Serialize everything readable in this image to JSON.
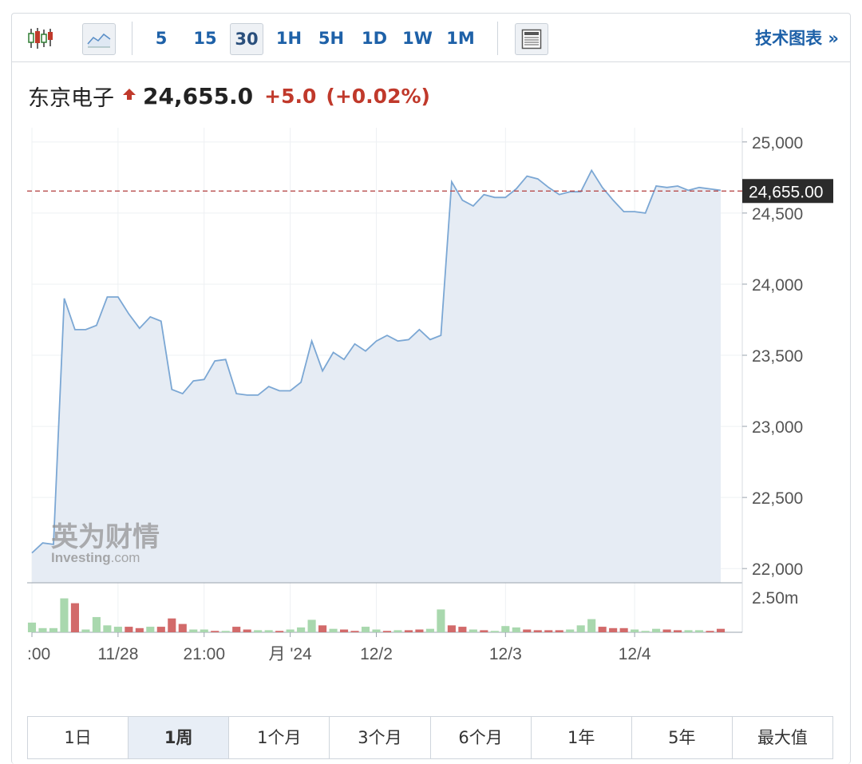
{
  "toolbar": {
    "icons": [
      "candlestick-icon",
      "area-chart-icon",
      "table-view-icon"
    ],
    "intervals": [
      "5",
      "15",
      "30",
      "1H",
      "5H",
      "1D",
      "1W",
      "1M"
    ],
    "active_interval": "30",
    "tech_chart_link": "技术图表 »"
  },
  "quote": {
    "name": "东京电子",
    "price": "24,655.0",
    "change": "+5.0",
    "change_pct": "(+0.02%)"
  },
  "watermark": {
    "cn": "英为财情",
    "en": "Investing",
    "en_suffix": ".com"
  },
  "ranges": [
    "1日",
    "1周",
    "1个月",
    "3个月",
    "6个月",
    "1年",
    "5年",
    "最大值"
  ],
  "active_range": "1周",
  "colors": {
    "line": "#7ba7d4",
    "area": "#e6ecf4",
    "up_volume": "#a9d8ae",
    "down_volume": "#d26a6a",
    "price_marker": "#2b2b2b",
    "last_price_line": "#b84c4c",
    "accent": "#1e61a8",
    "change_red": "#c0392b"
  },
  "chart_data": {
    "type": "area",
    "ylim": [
      21900,
      25100
    ],
    "y_ticks": [
      22000,
      22500,
      23000,
      23500,
      24000,
      24500,
      25000
    ],
    "y_tick_labels": [
      "22,000",
      "22,500",
      "23,000",
      "23,500",
      "24,000",
      "24,500",
      "25,000"
    ],
    "x_tick_labels": [
      ":00",
      "11/28",
      "21:00",
      "月 '24",
      "12/2",
      "12/3",
      "12/4"
    ],
    "x_tick_index": [
      0,
      8,
      16,
      24,
      32,
      44,
      56
    ],
    "last_price": 24655,
    "last_price_label": "24,655.00",
    "volume_label": "2.50m",
    "volume_max": 3000000,
    "grid": true,
    "series": [
      {
        "values": [
          22110,
          22180,
          22170,
          23900,
          23680,
          23680,
          23710,
          23910,
          23910,
          23790,
          23690,
          23770,
          23740,
          23260,
          23230,
          23320,
          23330,
          23460,
          23470,
          23230,
          23220,
          23220,
          23280,
          23250,
          23250,
          23310,
          23600,
          23390,
          23520,
          23470,
          23580,
          23530,
          23600,
          23640,
          23600,
          23610,
          23680,
          23610,
          23640,
          24720,
          24590,
          24550,
          24630,
          24610,
          24610,
          24670,
          24760,
          24740,
          24680,
          24630,
          24650,
          24650,
          24800,
          24680,
          24590,
          24510,
          24510,
          24500,
          24690,
          24680,
          24690,
          24660,
          24680,
          24670,
          24660
        ]
      }
    ],
    "volume": [
      {
        "v": 700000,
        "dir": "up"
      },
      {
        "v": 300000,
        "dir": "up"
      },
      {
        "v": 300000,
        "dir": "up"
      },
      {
        "v": 2450000,
        "dir": "up"
      },
      {
        "v": 2100000,
        "dir": "down"
      },
      {
        "v": 200000,
        "dir": "up"
      },
      {
        "v": 1100000,
        "dir": "up"
      },
      {
        "v": 500000,
        "dir": "up"
      },
      {
        "v": 400000,
        "dir": "up"
      },
      {
        "v": 400000,
        "dir": "down"
      },
      {
        "v": 300000,
        "dir": "down"
      },
      {
        "v": 400000,
        "dir": "up"
      },
      {
        "v": 400000,
        "dir": "down"
      },
      {
        "v": 1000000,
        "dir": "down"
      },
      {
        "v": 600000,
        "dir": "down"
      },
      {
        "v": 200000,
        "dir": "up"
      },
      {
        "v": 200000,
        "dir": "up"
      },
      {
        "v": 100000,
        "dir": "down"
      },
      {
        "v": 100000,
        "dir": "up"
      },
      {
        "v": 400000,
        "dir": "down"
      },
      {
        "v": 200000,
        "dir": "down"
      },
      {
        "v": 150000,
        "dir": "up"
      },
      {
        "v": 150000,
        "dir": "up"
      },
      {
        "v": 100000,
        "dir": "down"
      },
      {
        "v": 200000,
        "dir": "up"
      },
      {
        "v": 350000,
        "dir": "up"
      },
      {
        "v": 900000,
        "dir": "up"
      },
      {
        "v": 500000,
        "dir": "down"
      },
      {
        "v": 250000,
        "dir": "up"
      },
      {
        "v": 200000,
        "dir": "down"
      },
      {
        "v": 100000,
        "dir": "down"
      },
      {
        "v": 400000,
        "dir": "up"
      },
      {
        "v": 200000,
        "dir": "up"
      },
      {
        "v": 100000,
        "dir": "down"
      },
      {
        "v": 150000,
        "dir": "up"
      },
      {
        "v": 150000,
        "dir": "down"
      },
      {
        "v": 200000,
        "dir": "down"
      },
      {
        "v": 250000,
        "dir": "up"
      },
      {
        "v": 1650000,
        "dir": "up"
      },
      {
        "v": 500000,
        "dir": "down"
      },
      {
        "v": 400000,
        "dir": "down"
      },
      {
        "v": 200000,
        "dir": "up"
      },
      {
        "v": 150000,
        "dir": "down"
      },
      {
        "v": 100000,
        "dir": "up"
      },
      {
        "v": 450000,
        "dir": "up"
      },
      {
        "v": 350000,
        "dir": "up"
      },
      {
        "v": 200000,
        "dir": "down"
      },
      {
        "v": 150000,
        "dir": "down"
      },
      {
        "v": 150000,
        "dir": "down"
      },
      {
        "v": 150000,
        "dir": "down"
      },
      {
        "v": 200000,
        "dir": "up"
      },
      {
        "v": 500000,
        "dir": "up"
      },
      {
        "v": 950000,
        "dir": "up"
      },
      {
        "v": 400000,
        "dir": "down"
      },
      {
        "v": 300000,
        "dir": "down"
      },
      {
        "v": 300000,
        "dir": "down"
      },
      {
        "v": 200000,
        "dir": "up"
      },
      {
        "v": 100000,
        "dir": "up"
      },
      {
        "v": 250000,
        "dir": "up"
      },
      {
        "v": 200000,
        "dir": "down"
      },
      {
        "v": 150000,
        "dir": "down"
      },
      {
        "v": 150000,
        "dir": "up"
      },
      {
        "v": 150000,
        "dir": "up"
      },
      {
        "v": 100000,
        "dir": "down"
      },
      {
        "v": 250000,
        "dir": "down"
      }
    ]
  }
}
